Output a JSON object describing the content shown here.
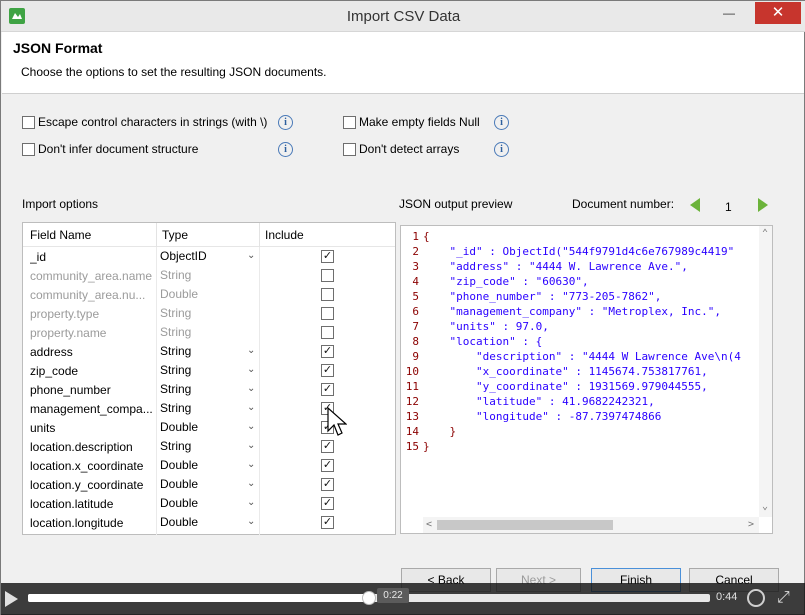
{
  "window": {
    "title": "Import CSV Data",
    "min_label": "—",
    "max_label": "□",
    "close_label": "✕"
  },
  "header": {
    "title": "JSON Format",
    "subtitle": "Choose the options to set the resulting JSON documents."
  },
  "options": {
    "escape_label": "Escape control characters in strings (with \\)",
    "no_infer_label": "Don't infer document structure",
    "empty_null_label": "Make empty fields Null",
    "no_arrays_label": "Don't detect arrays",
    "info_glyph": "i"
  },
  "import_options": {
    "label": "Import options",
    "columns": [
      "Field Name",
      "Type",
      "Include"
    ],
    "rows": [
      {
        "name": "_id",
        "type": "ObjectID",
        "muted": false,
        "dropdown": true,
        "include": true
      },
      {
        "name": "community_area.name",
        "type": "String",
        "muted": true,
        "dropdown": false,
        "include": false
      },
      {
        "name": "community_area.nu...",
        "type": "Double",
        "muted": true,
        "dropdown": false,
        "include": false
      },
      {
        "name": "property.type",
        "type": "String",
        "muted": true,
        "dropdown": false,
        "include": false
      },
      {
        "name": "property.name",
        "type": "String",
        "muted": true,
        "dropdown": false,
        "include": false
      },
      {
        "name": "address",
        "type": "String",
        "muted": false,
        "dropdown": true,
        "include": true
      },
      {
        "name": "zip_code",
        "type": "String",
        "muted": false,
        "dropdown": true,
        "include": true
      },
      {
        "name": "phone_number",
        "type": "String",
        "muted": false,
        "dropdown": true,
        "include": true
      },
      {
        "name": "management_compa...",
        "type": "String",
        "muted": false,
        "dropdown": true,
        "include": true
      },
      {
        "name": "units",
        "type": "Double",
        "muted": false,
        "dropdown": true,
        "include": true
      },
      {
        "name": "location.description",
        "type": "String",
        "muted": false,
        "dropdown": true,
        "include": true
      },
      {
        "name": "location.x_coordinate",
        "type": "Double",
        "muted": false,
        "dropdown": true,
        "include": true
      },
      {
        "name": "location.y_coordinate",
        "type": "Double",
        "muted": false,
        "dropdown": true,
        "include": true
      },
      {
        "name": "location.latitude",
        "type": "Double",
        "muted": false,
        "dropdown": true,
        "include": true
      },
      {
        "name": "location.longitude",
        "type": "Double",
        "muted": false,
        "dropdown": true,
        "include": true
      }
    ]
  },
  "preview": {
    "label": "JSON output preview",
    "document_number_label": "Document number:",
    "document_number": "1",
    "lines": [
      {
        "n": "1",
        "text": "{"
      },
      {
        "n": "2",
        "text": "    \"_id\" : ObjectId(\"544f9791d4c6e767989c4419\""
      },
      {
        "n": "3",
        "text": "    \"address\" : \"4444 W. Lawrence Ave.\","
      },
      {
        "n": "4",
        "text": "    \"zip_code\" : \"60630\","
      },
      {
        "n": "5",
        "text": "    \"phone_number\" : \"773-205-7862\","
      },
      {
        "n": "6",
        "text": "    \"management_company\" : \"Metroplex, Inc.\","
      },
      {
        "n": "7",
        "text": "    \"units\" : 97.0,"
      },
      {
        "n": "8",
        "text": "    \"location\" : {"
      },
      {
        "n": "9",
        "text": "        \"description\" : \"4444 W Lawrence Ave\\n(4"
      },
      {
        "n": "10",
        "text": "        \"x_coordinate\" : 1145674.753817761,"
      },
      {
        "n": "11",
        "text": "        \"y_coordinate\" : 1931569.979044555,"
      },
      {
        "n": "12",
        "text": "        \"latitude\" : 41.9682242321,"
      },
      {
        "n": "13",
        "text": "        \"longitude\" : -87.7397474866"
      },
      {
        "n": "14",
        "text": "    }"
      },
      {
        "n": "15",
        "text": "}"
      }
    ]
  },
  "buttons": {
    "back": "< Back",
    "next": "Next >",
    "finish": "Finish",
    "cancel": "Cancel"
  },
  "video": {
    "tooltip_time": "0:22",
    "time": "0:44",
    "progress_fraction": 0.5
  },
  "colors": {
    "accent_green": "#6bb33a",
    "close_red": "#c7352d",
    "code_string": "#2a00ff",
    "line_number": "#8b0000"
  }
}
